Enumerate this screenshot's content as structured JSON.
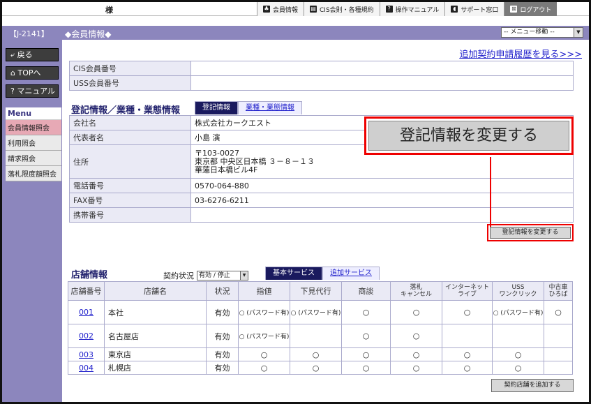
{
  "topbar": {
    "user_suffix": "様",
    "nav": [
      {
        "icon": "♣",
        "label": "会員情報"
      },
      {
        "icon": "▤",
        "label": "CIS会則・各種規約"
      },
      {
        "icon": "?",
        "label": "操作マニュアル"
      },
      {
        "icon": "◖",
        "label": "サポート窓口"
      },
      {
        "icon": "⊠",
        "label": "ログアウト"
      }
    ]
  },
  "header": {
    "code": "【J-2141】",
    "title": "◆会員情報◆",
    "menu_select": "-- メニュー移動 --"
  },
  "sidebar": {
    "back": "⤶ 戻る",
    "top": "⌂ TOPへ",
    "manual": "? マニュアル",
    "menu_title": "Menu",
    "menu_items": [
      "会員情報照会",
      "利用照会",
      "請求照会",
      "落札限度額照会"
    ]
  },
  "main": {
    "history_link": "追加契約申請履歴を見る>>>",
    "cis_label": "CIS会員番号",
    "cis_value": "",
    "uss_label": "USS会員番号",
    "uss_value": "",
    "section_title": "登記情報／業種・業態情報",
    "tab_on": "登記情報",
    "tab_off": "業種・業態情報",
    "rows": [
      {
        "label": "会社名",
        "value": "株式会社カークエスト"
      },
      {
        "label": "代表者名",
        "value": "小島 演"
      },
      {
        "label": "住所",
        "value": "〒103-0027",
        "value2": "東京都 中央区日本橋 ３－８－１３",
        "value3": "華蓮日本橋ビル4F"
      },
      {
        "label": "電話番号",
        "value": "0570-064-880"
      },
      {
        "label": "FAX番号",
        "value": "03-6276-6211"
      },
      {
        "label": "携帯番号",
        "value": ""
      }
    ],
    "callout_label": "登記情報を変更する",
    "change_button": "登記情報を変更する"
  },
  "shops": {
    "title": "店舗情報",
    "contract_label": "契約状況",
    "contract_select": "有効 / 停止",
    "tab_basic": "基本サービス",
    "tab_extra": "追加サービス",
    "headers": [
      "店舗番号",
      "店舗名",
      "状況",
      "指値",
      "下見代行",
      "商談",
      "落札\nキャンセル",
      "インターネット\nライブ",
      "USS\nワンクリック",
      "中古車\nひろば"
    ],
    "rows": [
      {
        "no": "001",
        "name": "本社",
        "status": "有効",
        "c": [
          "○ (パスワード有)",
          "○ (パスワード有)",
          "○",
          "○",
          "○",
          "○ (パスワード有)",
          "○"
        ]
      },
      {
        "no": "002",
        "name": "名古屋店",
        "status": "有効",
        "c": [
          "○ (パスワード有)",
          "",
          "○",
          "○",
          "",
          "",
          ""
        ]
      },
      {
        "no": "003",
        "name": "東京店",
        "status": "有効",
        "c": [
          "○",
          "○",
          "○",
          "○",
          "○",
          "○",
          ""
        ]
      },
      {
        "no": "004",
        "name": "札幌店",
        "status": "有効",
        "c": [
          "○",
          "○",
          "○",
          "○",
          "○",
          "○",
          ""
        ]
      }
    ],
    "add_button": "契約店舗を追加する"
  }
}
